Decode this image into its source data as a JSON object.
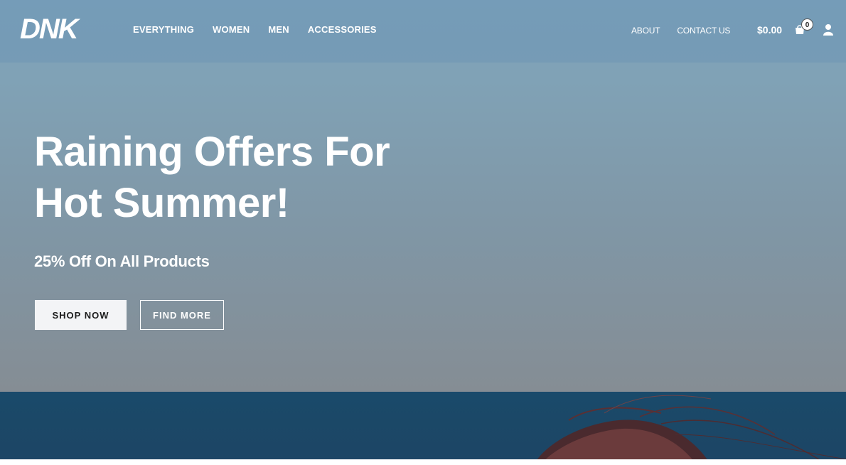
{
  "brand": {
    "logo_text": "DNK"
  },
  "nav": {
    "main": [
      "EVERYTHING",
      "WOMEN",
      "MEN",
      "ACCESSORIES"
    ],
    "secondary": [
      "ABOUT",
      "CONTACT US"
    ]
  },
  "cart": {
    "total": "$0.00",
    "count": "0",
    "icon": "shopping-bag-icon"
  },
  "account": {
    "icon": "user-icon"
  },
  "hero": {
    "headline_line1": "Raining Offers For",
    "headline_line2": "Hot Summer!",
    "subheadline": "25% Off On All Products",
    "primary_button": "SHOP NOW",
    "secondary_button": "FIND MORE"
  },
  "colors": {
    "hero_top": "#7ea4bc",
    "hero_bottom": "#858d94",
    "sea": "#1a4a6b",
    "button_light": "#f3f4f6",
    "text_white": "#ffffff"
  }
}
